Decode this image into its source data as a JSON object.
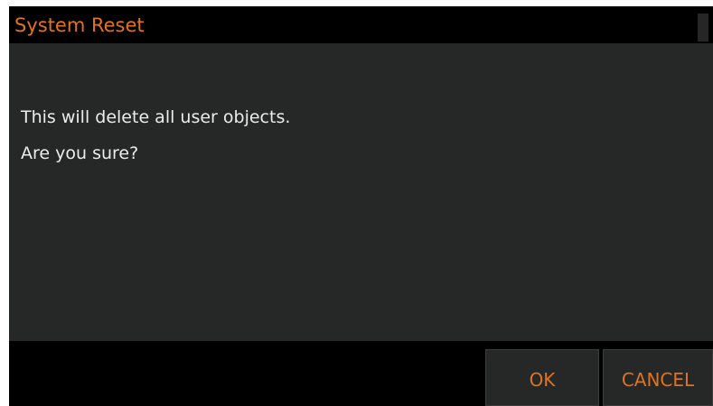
{
  "dialog": {
    "title": "System Reset",
    "message_lines": [
      "This will delete all user objects.",
      "Are you sure?"
    ],
    "buttons": {
      "ok_label": "OK",
      "cancel_label": "CANCEL"
    }
  },
  "colors": {
    "accent": "#e0731e",
    "text": "#ececec",
    "panel": "#262727",
    "frame": "#000000"
  }
}
